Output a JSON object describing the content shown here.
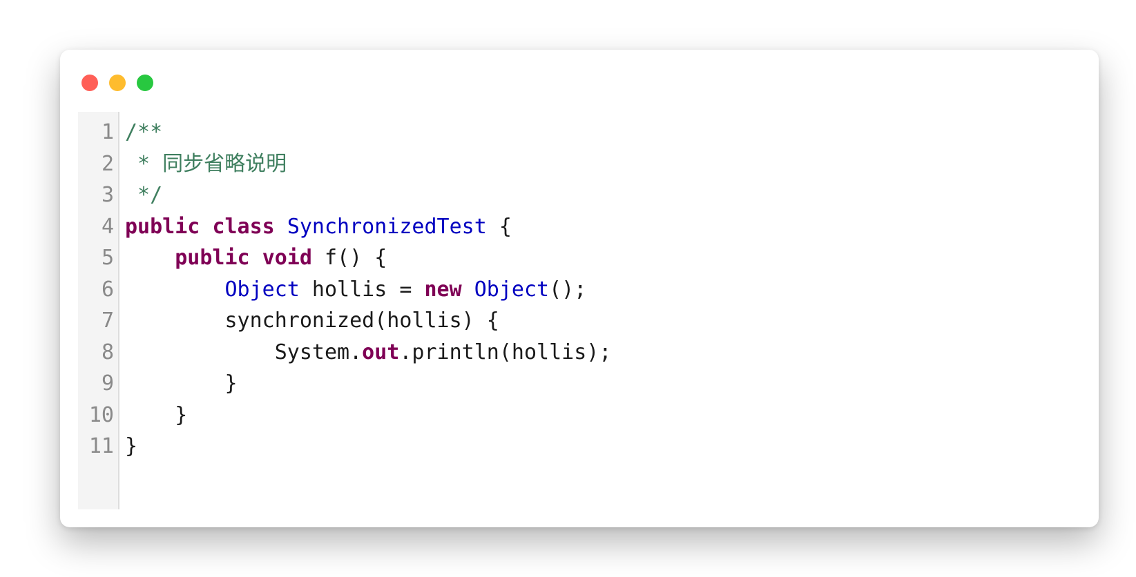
{
  "window": {
    "controls": {
      "close": "close",
      "minimize": "minimize",
      "zoom": "zoom"
    }
  },
  "editor": {
    "line_numbers": [
      "1",
      "2",
      "3",
      "4",
      "5",
      "6",
      "7",
      "8",
      "9",
      "10",
      "11"
    ],
    "lines": [
      [
        {
          "t": "/**",
          "c": "cmt"
        }
      ],
      [
        {
          "t": " * 同步省略说明",
          "c": "cmt"
        }
      ],
      [
        {
          "t": " */",
          "c": "cmt"
        }
      ],
      [
        {
          "t": "public",
          "c": "kw"
        },
        {
          "t": " ",
          "c": "pl"
        },
        {
          "t": "class",
          "c": "kw"
        },
        {
          "t": " ",
          "c": "pl"
        },
        {
          "t": "SynchronizedTest",
          "c": "ty"
        },
        {
          "t": " {",
          "c": "pl"
        }
      ],
      [
        {
          "t": "    ",
          "c": "pl"
        },
        {
          "t": "public",
          "c": "kw"
        },
        {
          "t": " ",
          "c": "pl"
        },
        {
          "t": "void",
          "c": "kw"
        },
        {
          "t": " f() {",
          "c": "pl"
        }
      ],
      [
        {
          "t": "        ",
          "c": "pl"
        },
        {
          "t": "Object",
          "c": "ty"
        },
        {
          "t": " hollis = ",
          "c": "pl"
        },
        {
          "t": "new",
          "c": "kw"
        },
        {
          "t": " ",
          "c": "pl"
        },
        {
          "t": "Object",
          "c": "ty"
        },
        {
          "t": "();",
          "c": "pl"
        }
      ],
      [
        {
          "t": "        synchronized(hollis) {",
          "c": "pl"
        }
      ],
      [
        {
          "t": "            System.",
          "c": "pl"
        },
        {
          "t": "out",
          "c": "fld"
        },
        {
          "t": ".println(hollis);",
          "c": "pl"
        }
      ],
      [
        {
          "t": "        }",
          "c": "pl"
        }
      ],
      [
        {
          "t": "    }",
          "c": "pl"
        }
      ],
      [
        {
          "t": "}",
          "c": "pl"
        }
      ]
    ]
  }
}
